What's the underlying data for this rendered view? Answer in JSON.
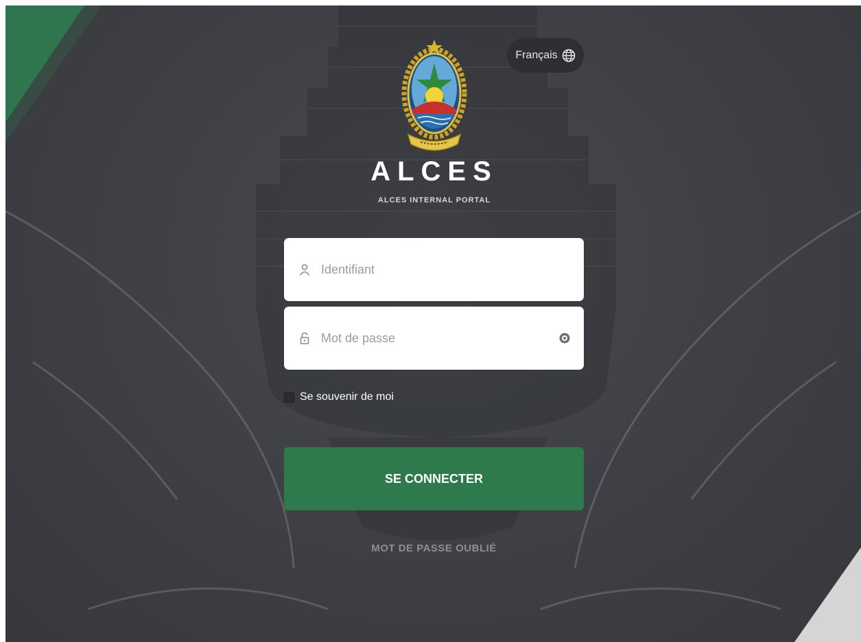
{
  "language": {
    "label": "Français",
    "icon": "globe-icon"
  },
  "brand": {
    "title": "ALCES",
    "subtitle": "ALCES INTERNAL PORTAL",
    "logo": "coat-of-arms-emblem"
  },
  "form": {
    "username": {
      "placeholder": "Identifiant",
      "value": "",
      "icon": "user-icon"
    },
    "password": {
      "placeholder": "Mot de passe",
      "value": "",
      "icon": "lock-icon",
      "toggle_icon": "eye-icon"
    },
    "remember_label": "Se souvenir de moi",
    "submit_label": "SE CONNECTER",
    "forgot_label": "MOT DE PASSE OUBLIÉ"
  },
  "colors": {
    "primary_button": "#2e7a4d",
    "background": "#3f4146",
    "accent_green": "#2f7a50"
  }
}
